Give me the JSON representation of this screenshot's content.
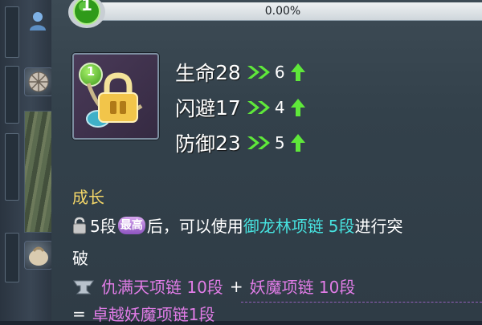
{
  "player": {
    "level": "1",
    "xp_percent": "0.00%",
    "xp_fill": 0.0
  },
  "item": {
    "level": "1",
    "icon": "locked-necklace-icon",
    "stats": [
      {
        "label": "生命",
        "value": "28",
        "add": "6"
      },
      {
        "label": "闪避",
        "value": "17",
        "add": "4"
      },
      {
        "label": "防御",
        "value": "23",
        "add": "5"
      }
    ]
  },
  "growth": {
    "title": "成长",
    "line1_a": "5段",
    "badge": "最高",
    "line1_b": "后，可以使用",
    "line1_item": "御龙林项链",
    "line1_tier": "5段",
    "line1_c": "进行突",
    "line2": "破",
    "recipe_a": "仇满天项链 10段",
    "recipe_plus": "+",
    "recipe_b": "妖魔项链 10段",
    "result_eq": "=",
    "result": "卓越妖魔项链1段"
  },
  "colors": {
    "green": "#5fe83a",
    "cyan": "#47e2df",
    "pink": "#e07ce6",
    "gold": "#f4d768"
  }
}
